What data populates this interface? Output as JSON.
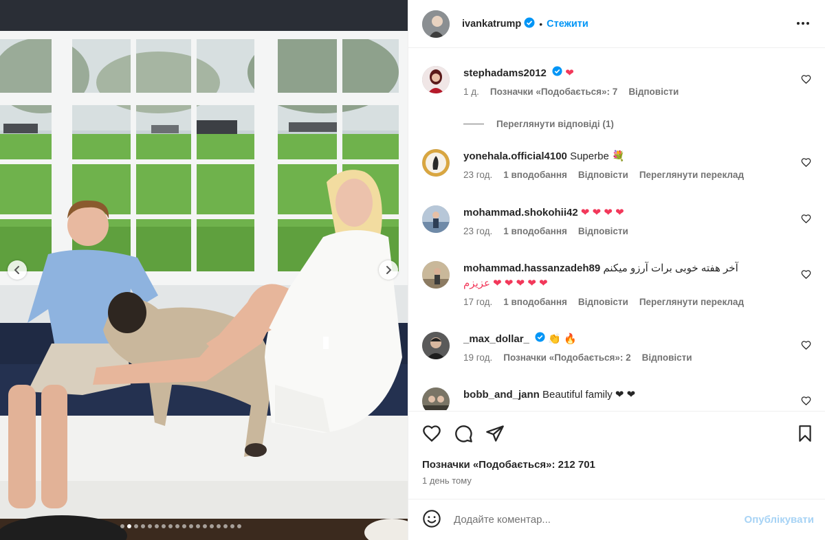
{
  "post": {
    "username": "ivankatrump",
    "separator": "•",
    "follow_label": "Стежити",
    "carousel_dots": 18,
    "active_dot": 1
  },
  "comments": [
    {
      "username": "stephadams2012",
      "verified": true,
      "text": "❤",
      "time": "1 д.",
      "likes": "Позначки «Подобається»: 7",
      "reply": "Відповісти",
      "translate": "",
      "avatar_color": "#8a2a2a"
    },
    {
      "username": "yonehala.official4100",
      "verified": false,
      "text": "Superbe 💐",
      "time": "23 год.",
      "likes": "1 вподобання",
      "reply": "Відповісти",
      "translate": "Переглянути переклад",
      "avatar_color": "#d9a640"
    },
    {
      "username": "mohammad.shokohii42",
      "verified": false,
      "text": "❤ ❤ ❤ ❤",
      "time": "23 год.",
      "likes": "1 вподобання",
      "reply": "Відповісти",
      "translate": "",
      "avatar_color": "#7b8da3"
    },
    {
      "username": "mohammad.hassanzadeh89",
      "verified": false,
      "text": "آخر هفته خوبی برات آرزو میکنم",
      "text2": "❤ ❤ ❤ ❤ ❤ عزیزم",
      "time": "17 год.",
      "likes": "1 вподобання",
      "reply": "Відповісти",
      "translate": "Переглянути переклад",
      "avatar_color": "#8c7b62"
    },
    {
      "username": "_max_dollar_",
      "verified": true,
      "text": "👏 🔥",
      "time": "19 год.",
      "likes": "Позначки «Подобається»: 2",
      "reply": "Відповісти",
      "translate": "",
      "avatar_color": "#3b3b3b"
    },
    {
      "username": "bobb_and_jann",
      "verified": false,
      "text": "Beautiful family ❤ ❤",
      "time": "",
      "likes": "",
      "reply": "",
      "translate": "",
      "avatar_color": "#6e6a5a"
    }
  ],
  "view_replies": "Переглянути відповіді (1)",
  "actions": {
    "likes_total": "Позначки «Подобається»: 212 701",
    "date": "1 день тому"
  },
  "add_comment": {
    "placeholder": "Додайте коментар...",
    "post_label": "Опублікувати"
  },
  "colors": {
    "accent": "#0095f6",
    "verified": "#0095f6",
    "heart": "#f2385a",
    "post_disabled": "#a7d3f5"
  }
}
